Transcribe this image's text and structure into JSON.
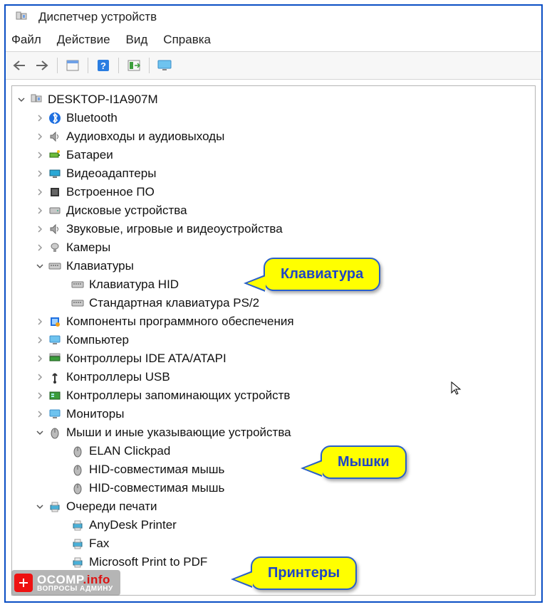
{
  "window": {
    "title": "Диспетчер устройств"
  },
  "menu": {
    "file": "Файл",
    "action": "Действие",
    "view": "Вид",
    "help": "Справка"
  },
  "root": {
    "label": "DESKTOP-I1A907M"
  },
  "nodes": [
    {
      "label": "Bluetooth",
      "depth": 1,
      "arrow": "right",
      "icon": "bluetooth"
    },
    {
      "label": "Аудиовходы и аудиовыходы",
      "depth": 1,
      "arrow": "right",
      "icon": "audio"
    },
    {
      "label": "Батареи",
      "depth": 1,
      "arrow": "right",
      "icon": "battery"
    },
    {
      "label": "Видеоадаптеры",
      "depth": 1,
      "arrow": "right",
      "icon": "display-adapter"
    },
    {
      "label": "Встроенное ПО",
      "depth": 1,
      "arrow": "right",
      "icon": "firmware"
    },
    {
      "label": "Дисковые устройства",
      "depth": 1,
      "arrow": "right",
      "icon": "disk"
    },
    {
      "label": "Звуковые, игровые и видеоустройства",
      "depth": 1,
      "arrow": "right",
      "icon": "audio"
    },
    {
      "label": "Камеры",
      "depth": 1,
      "arrow": "right",
      "icon": "camera"
    },
    {
      "label": "Клавиатуры",
      "depth": 1,
      "arrow": "down",
      "icon": "keyboard"
    },
    {
      "label": "Клавиатура HID",
      "depth": 2,
      "arrow": "none",
      "icon": "keyboard"
    },
    {
      "label": "Стандартная клавиатура PS/2",
      "depth": 2,
      "arrow": "none",
      "icon": "keyboard"
    },
    {
      "label": "Компоненты программного обеспечения",
      "depth": 1,
      "arrow": "right",
      "icon": "software"
    },
    {
      "label": "Компьютер",
      "depth": 1,
      "arrow": "right",
      "icon": "computer"
    },
    {
      "label": "Контроллеры IDE ATA/ATAPI",
      "depth": 1,
      "arrow": "right",
      "icon": "ide"
    },
    {
      "label": "Контроллеры USB",
      "depth": 1,
      "arrow": "right",
      "icon": "usb"
    },
    {
      "label": "Контроллеры запоминающих устройств",
      "depth": 1,
      "arrow": "right",
      "icon": "storage"
    },
    {
      "label": "Мониторы",
      "depth": 1,
      "arrow": "right",
      "icon": "monitor"
    },
    {
      "label": "Мыши и иные указывающие устройства",
      "depth": 1,
      "arrow": "down",
      "icon": "mouse"
    },
    {
      "label": "ELAN Clickpad",
      "depth": 2,
      "arrow": "none",
      "icon": "mouse"
    },
    {
      "label": "HID-совместимая мышь",
      "depth": 2,
      "arrow": "none",
      "icon": "mouse"
    },
    {
      "label": "HID-совместимая мышь",
      "depth": 2,
      "arrow": "none",
      "icon": "mouse"
    },
    {
      "label": "Очереди печати",
      "depth": 1,
      "arrow": "down",
      "icon": "printer"
    },
    {
      "label": "AnyDesk Printer",
      "depth": 2,
      "arrow": "none",
      "icon": "printer"
    },
    {
      "label": "Fax",
      "depth": 2,
      "arrow": "none",
      "icon": "printer"
    },
    {
      "label": "Microsoft Print to PDF",
      "depth": 2,
      "arrow": "none",
      "icon": "printer"
    }
  ],
  "callouts": {
    "c1": "Клавиатура",
    "c2": "Мышки",
    "c3": "Принтеры"
  },
  "watermark": {
    "main": "OCOMP",
    "suffix": ".info",
    "sub": "ВОПРОСЫ АДМИНУ"
  }
}
